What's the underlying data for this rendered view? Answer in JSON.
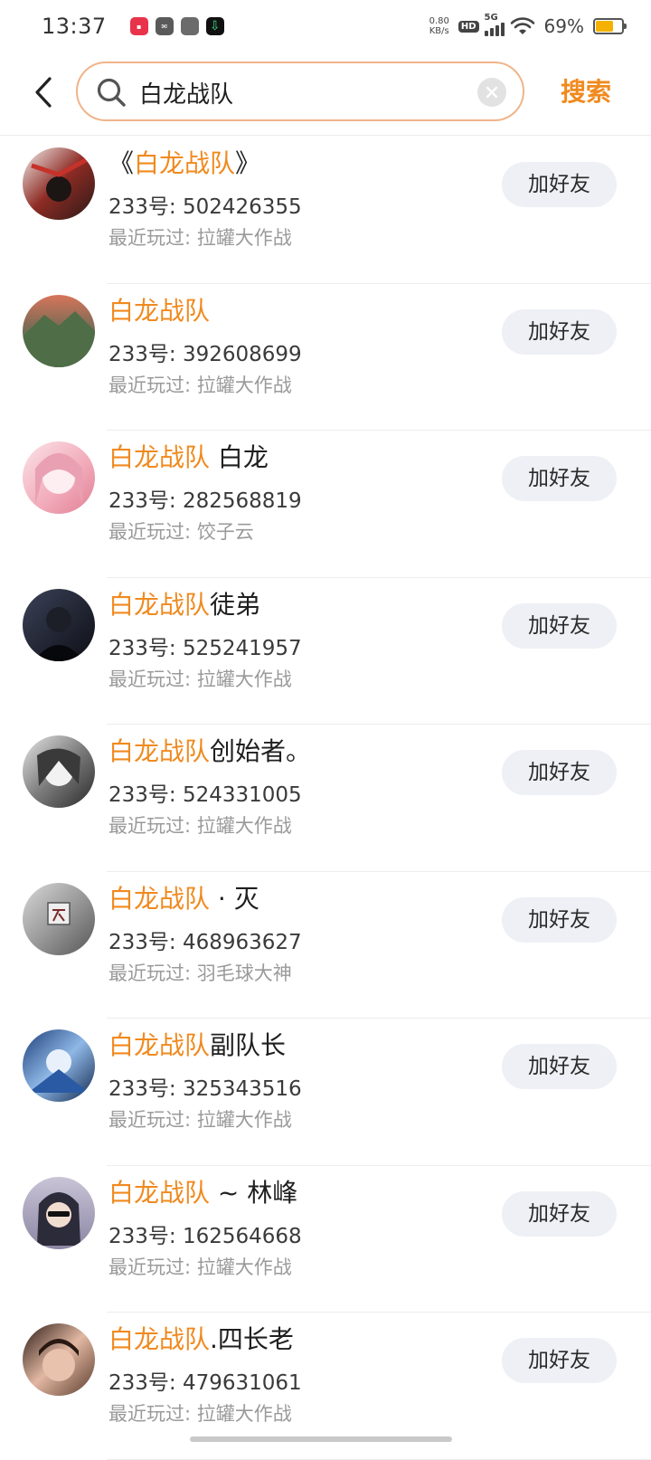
{
  "status_bar": {
    "time": "13:37",
    "net_speed_value": "0.80",
    "net_speed_unit": "KB/s",
    "hd_label": "HD",
    "network_type": "5G",
    "battery_percent_text": "69%",
    "battery_level": 0.69,
    "app_icons": [
      "app-icon-red",
      "app-icon-mail",
      "app-icon-gray",
      "app-icon-download"
    ]
  },
  "header": {
    "search_query": "白龙战队",
    "search_button_label": "搜索"
  },
  "colors": {
    "accent": "#f08a1f",
    "search_border": "#f0b48a",
    "button_bg": "#eef0f5"
  },
  "results": [
    {
      "name_prefix": "《",
      "name_highlight": "白龙战队",
      "name_suffix": "》",
      "id_label": "233号:",
      "id_value": "502426355",
      "recent_label": "最近玩过:",
      "recent_game": "拉罐大作战",
      "button_label": "加好友"
    },
    {
      "name_prefix": "",
      "name_highlight": "白龙战队",
      "name_suffix": "",
      "id_label": "233号:",
      "id_value": "392608699",
      "recent_label": "最近玩过:",
      "recent_game": "拉罐大作战",
      "button_label": "加好友"
    },
    {
      "name_prefix": "",
      "name_highlight": "白龙战队",
      "name_suffix": " 白龙",
      "id_label": "233号:",
      "id_value": "282568819",
      "recent_label": "最近玩过:",
      "recent_game": "饺子云",
      "button_label": "加好友"
    },
    {
      "name_prefix": "",
      "name_highlight": "白龙战队",
      "name_suffix": "徒弟",
      "id_label": "233号:",
      "id_value": "525241957",
      "recent_label": "最近玩过:",
      "recent_game": "拉罐大作战",
      "button_label": "加好友"
    },
    {
      "name_prefix": "",
      "name_highlight": "白龙战队",
      "name_suffix": "创始者。",
      "id_label": "233号:",
      "id_value": "524331005",
      "recent_label": "最近玩过:",
      "recent_game": "拉罐大作战",
      "button_label": "加好友"
    },
    {
      "name_prefix": "",
      "name_highlight": "白龙战队",
      "name_suffix": " · 灭",
      "id_label": "233号:",
      "id_value": "468963627",
      "recent_label": "最近玩过:",
      "recent_game": "羽毛球大神",
      "button_label": "加好友"
    },
    {
      "name_prefix": "",
      "name_highlight": "白龙战队",
      "name_suffix": "副队长",
      "id_label": "233号:",
      "id_value": "325343516",
      "recent_label": "最近玩过:",
      "recent_game": "拉罐大作战",
      "button_label": "加好友"
    },
    {
      "name_prefix": "",
      "name_highlight": "白龙战队",
      "name_suffix": " ~ 林峰",
      "id_label": "233号:",
      "id_value": "162564668",
      "recent_label": "最近玩过:",
      "recent_game": "拉罐大作战",
      "button_label": "加好友"
    },
    {
      "name_prefix": "",
      "name_highlight": "白龙战队",
      "name_suffix": ".四长老",
      "id_label": "233号:",
      "id_value": "479631061",
      "recent_label": "最近玩过:",
      "recent_game": "拉罐大作战",
      "button_label": "加好友"
    }
  ]
}
